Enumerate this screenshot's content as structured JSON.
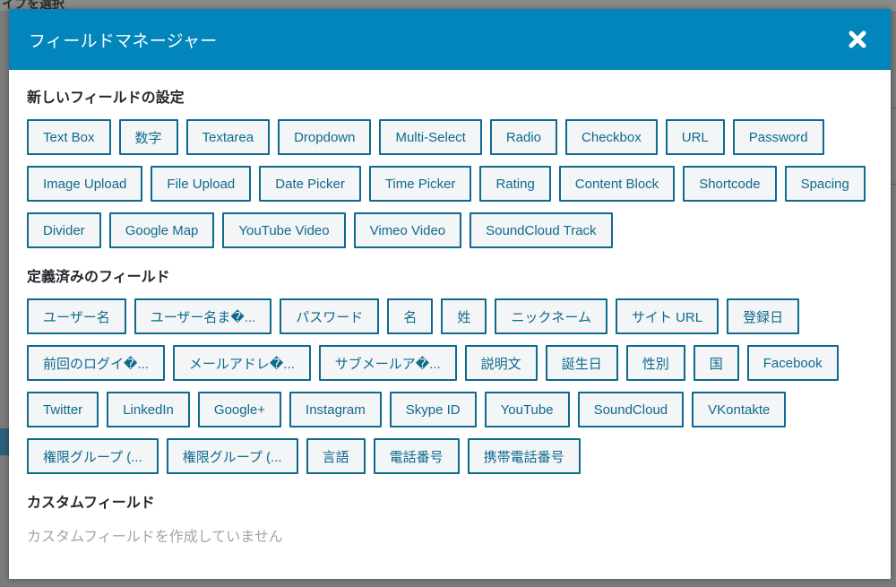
{
  "modal": {
    "title": "フィールドマネージャー",
    "accent_color": "#0285ba",
    "close_icon": "close-icon"
  },
  "sections": {
    "new_fields": {
      "title": "新しいフィールドの設定",
      "buttons": [
        "Text Box",
        "数字",
        "Textarea",
        "Dropdown",
        "Multi-Select",
        "Radio",
        "Checkbox",
        "URL",
        "Password",
        "Image Upload",
        "File Upload",
        "Date Picker",
        "Time Picker",
        "Rating",
        "Content Block",
        "Shortcode",
        "Spacing",
        "Divider",
        "Google Map",
        "YouTube Video",
        "Vimeo Video",
        "SoundCloud Track"
      ]
    },
    "predefined_fields": {
      "title": "定義済みのフィールド",
      "buttons": [
        "ユーザー名",
        "ユーザー名ま�...",
        "パスワード",
        "名",
        "姓",
        "ニックネーム",
        "サイト URL",
        "登録日",
        "前回のログイ�...",
        "メールアドレ�...",
        "サブメールア�...",
        "説明文",
        "誕生日",
        "性別",
        "国",
        "Facebook",
        "Twitter",
        "LinkedIn",
        "Google+",
        "Instagram",
        "Skype ID",
        "YouTube",
        "SoundCloud",
        "VKontakte",
        "権限グループ (...",
        "権限グループ (...",
        "言語",
        "電話番号",
        "携帯電話番号"
      ]
    },
    "custom_fields": {
      "title": "カスタムフィールド",
      "empty_message": "カスタムフィールドを作成していません"
    }
  },
  "background": {
    "partial_text": "イプを選択"
  }
}
